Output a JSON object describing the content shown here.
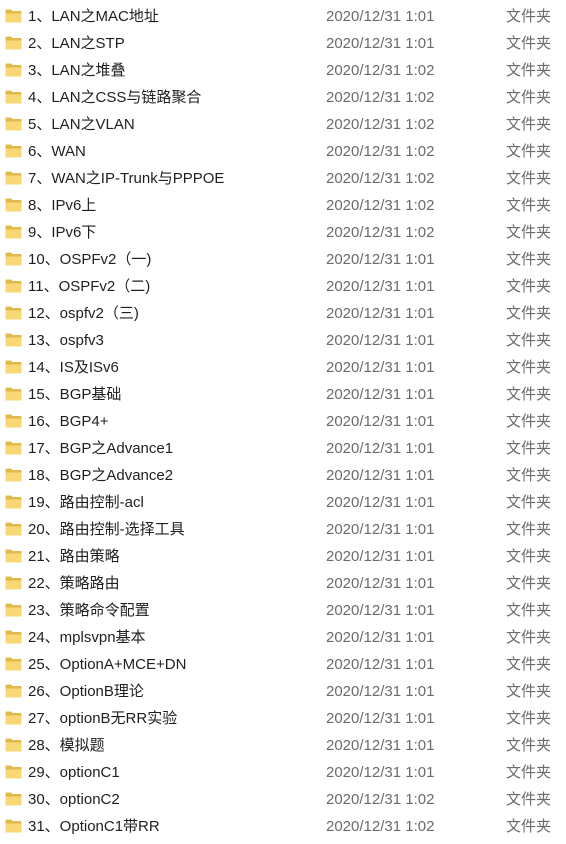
{
  "colors": {
    "folder_back": "#E2B94B",
    "folder_front": "#F8D775",
    "name_text": "#1f1f1f",
    "meta_text": "#6b6b6b"
  },
  "icon": "folder-icon",
  "rows": [
    {
      "name": "1、LAN之MAC地址",
      "date": "2020/12/31 1:01",
      "type": "文件夹"
    },
    {
      "name": "2、LAN之STP",
      "date": "2020/12/31 1:01",
      "type": "文件夹"
    },
    {
      "name": "3、LAN之堆叠",
      "date": "2020/12/31 1:02",
      "type": "文件夹"
    },
    {
      "name": "4、LAN之CSS与链路聚合",
      "date": "2020/12/31 1:02",
      "type": "文件夹"
    },
    {
      "name": "5、LAN之VLAN",
      "date": "2020/12/31 1:02",
      "type": "文件夹"
    },
    {
      "name": "6、WAN",
      "date": "2020/12/31 1:02",
      "type": "文件夹"
    },
    {
      "name": "7、WAN之IP-Trunk与PPPOE",
      "date": "2020/12/31 1:02",
      "type": "文件夹"
    },
    {
      "name": "8、IPv6上",
      "date": "2020/12/31 1:02",
      "type": "文件夹"
    },
    {
      "name": "9、IPv6下",
      "date": "2020/12/31 1:02",
      "type": "文件夹"
    },
    {
      "name": "10、OSPFv2（一)",
      "date": "2020/12/31 1:01",
      "type": "文件夹"
    },
    {
      "name": "11、OSPFv2（二)",
      "date": "2020/12/31 1:01",
      "type": "文件夹"
    },
    {
      "name": "12、ospfv2（三)",
      "date": "2020/12/31 1:01",
      "type": "文件夹"
    },
    {
      "name": "13、ospfv3",
      "date": "2020/12/31 1:01",
      "type": "文件夹"
    },
    {
      "name": "14、IS及ISv6",
      "date": "2020/12/31 1:01",
      "type": "文件夹"
    },
    {
      "name": "15、BGP基础",
      "date": "2020/12/31 1:01",
      "type": "文件夹"
    },
    {
      "name": "16、BGP4+",
      "date": "2020/12/31 1:01",
      "type": "文件夹"
    },
    {
      "name": "17、BGP之Advance1",
      "date": "2020/12/31 1:01",
      "type": "文件夹"
    },
    {
      "name": "18、BGP之Advance2",
      "date": "2020/12/31 1:01",
      "type": "文件夹"
    },
    {
      "name": "19、路由控制-acl",
      "date": "2020/12/31 1:01",
      "type": "文件夹"
    },
    {
      "name": "20、路由控制-选择工具",
      "date": "2020/12/31 1:01",
      "type": "文件夹"
    },
    {
      "name": "21、路由策略",
      "date": "2020/12/31 1:01",
      "type": "文件夹"
    },
    {
      "name": "22、策略路由",
      "date": "2020/12/31 1:01",
      "type": "文件夹"
    },
    {
      "name": "23、策略命令配置",
      "date": "2020/12/31 1:01",
      "type": "文件夹"
    },
    {
      "name": "24、mplsvpn基本",
      "date": "2020/12/31 1:01",
      "type": "文件夹"
    },
    {
      "name": "25、OptionA+MCE+DN",
      "date": "2020/12/31 1:01",
      "type": "文件夹"
    },
    {
      "name": "26、OptionB理论",
      "date": "2020/12/31 1:01",
      "type": "文件夹"
    },
    {
      "name": "27、optionB无RR实验",
      "date": "2020/12/31 1:01",
      "type": "文件夹"
    },
    {
      "name": "28、模拟题",
      "date": "2020/12/31 1:01",
      "type": "文件夹"
    },
    {
      "name": "29、optionC1",
      "date": "2020/12/31 1:01",
      "type": "文件夹"
    },
    {
      "name": "30、optionC2",
      "date": "2020/12/31 1:02",
      "type": "文件夹"
    },
    {
      "name": "31、OptionC1带RR",
      "date": "2020/12/31 1:02",
      "type": "文件夹"
    }
  ]
}
